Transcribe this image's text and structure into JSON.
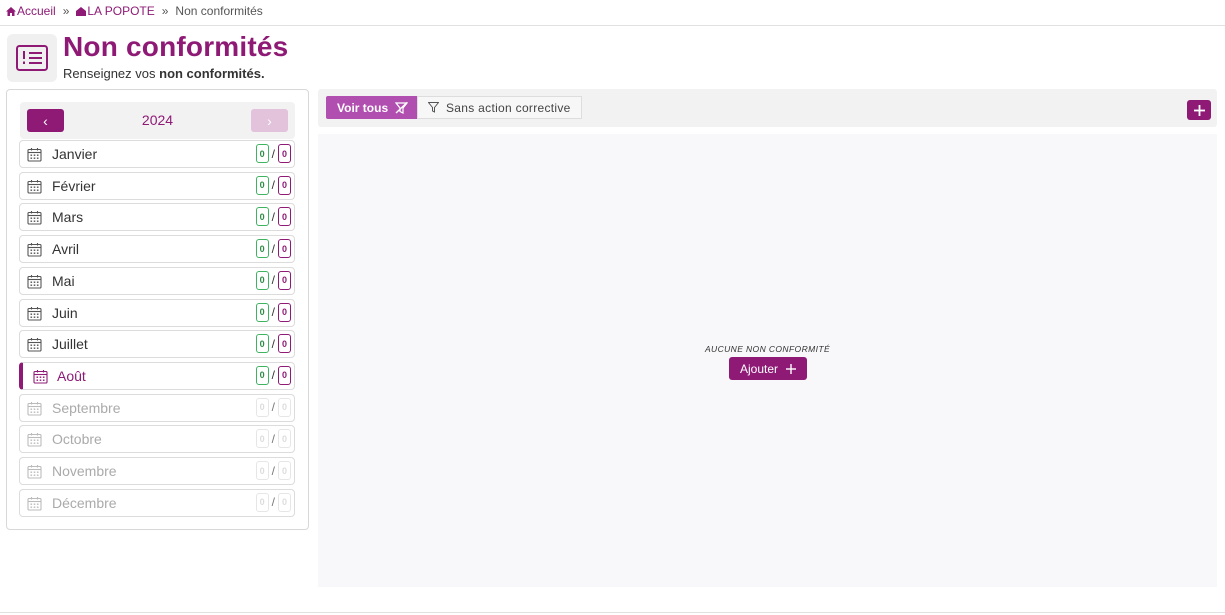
{
  "breadcrumb": {
    "home": "Accueil",
    "establishment": "LA POPOTE",
    "current": "Non conformités",
    "separator": "»"
  },
  "header": {
    "title": "Non conformités",
    "subtitle_prefix": "Renseignez vos",
    "subtitle_bold": "non conformités."
  },
  "calendar": {
    "year": "2024",
    "prev_label": "‹",
    "next_label": "›",
    "months": [
      {
        "label": "Janvier",
        "ok": "0",
        "total": "0",
        "state": "normal"
      },
      {
        "label": "Février",
        "ok": "0",
        "total": "0",
        "state": "normal"
      },
      {
        "label": "Mars",
        "ok": "0",
        "total": "0",
        "state": "normal"
      },
      {
        "label": "Avril",
        "ok": "0",
        "total": "0",
        "state": "normal"
      },
      {
        "label": "Mai",
        "ok": "0",
        "total": "0",
        "state": "normal"
      },
      {
        "label": "Juin",
        "ok": "0",
        "total": "0",
        "state": "normal"
      },
      {
        "label": "Juillet",
        "ok": "0",
        "total": "0",
        "state": "normal"
      },
      {
        "label": "Août",
        "ok": "0",
        "total": "0",
        "state": "active"
      },
      {
        "label": "Septembre",
        "ok": "0",
        "total": "0",
        "state": "disabled"
      },
      {
        "label": "Octobre",
        "ok": "0",
        "total": "0",
        "state": "disabled"
      },
      {
        "label": "Novembre",
        "ok": "0",
        "total": "0",
        "state": "disabled"
      },
      {
        "label": "Décembre",
        "ok": "0",
        "total": "0",
        "state": "disabled"
      }
    ]
  },
  "toolbar": {
    "show_all": "Voir tous",
    "no_corrective": "Sans action corrective",
    "add_icon": "plus-icon"
  },
  "content": {
    "empty_message": "AUCUNE NON CONFORMITÉ",
    "add_button": "Ajouter"
  },
  "colors": {
    "brand": "#8e1a76",
    "brand_light": "#b04fb0",
    "badge_green": "#3fb360"
  }
}
